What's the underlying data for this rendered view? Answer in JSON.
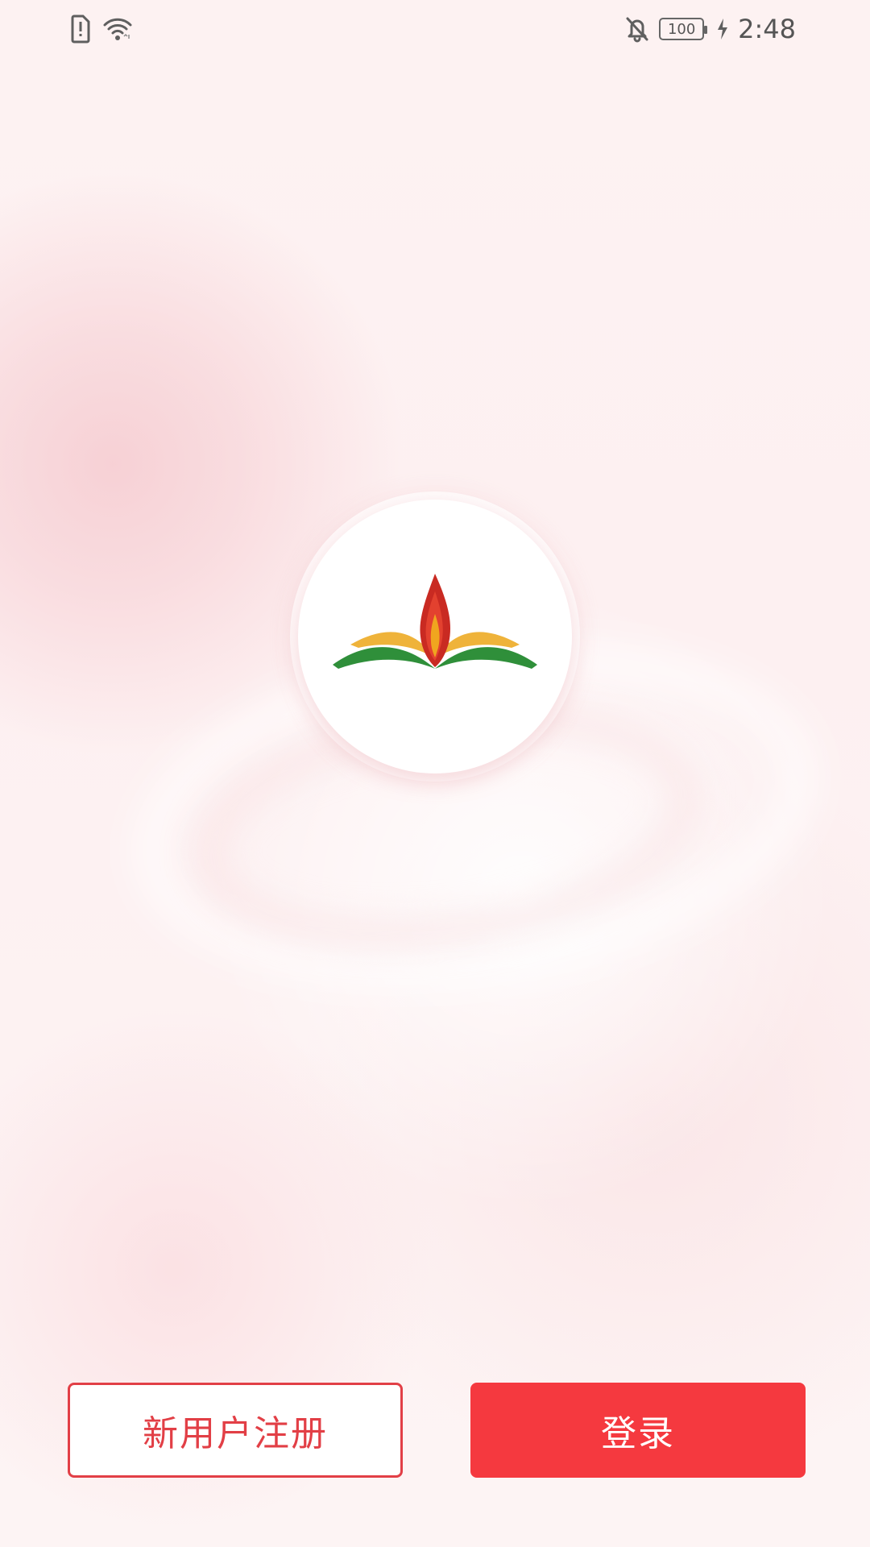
{
  "status_bar": {
    "left_icons": [
      "sim-alert-icon",
      "wifi-icon"
    ],
    "right_icons": [
      "bell-off-icon",
      "battery-icon",
      "charging-bolt-icon"
    ],
    "battery_text": "100",
    "time": "2:48"
  },
  "logo": {
    "icon": "open-book-flame-logo",
    "colors": {
      "flame_dark": "#c92a22",
      "flame_mid": "#e3412f",
      "flame_light": "#f0a51f",
      "book_yellow": "#efb33a",
      "book_green": "#2f8f3a"
    }
  },
  "actions": {
    "register_label": "新用户注册",
    "login_label": "登录"
  },
  "colors": {
    "accent_red": "#f5393f",
    "outline_red": "#e23f46",
    "background_pink": "#fdf1f1"
  }
}
